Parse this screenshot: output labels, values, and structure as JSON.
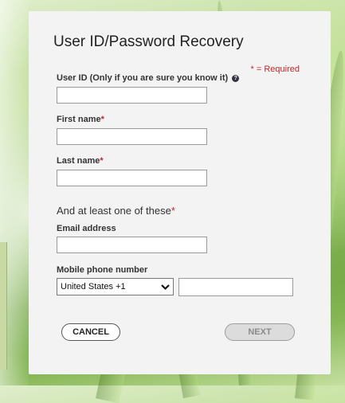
{
  "form": {
    "title": "User ID/Password Recovery",
    "required_note": "* = Required",
    "star": "*",
    "fields": {
      "user_id_label": "User ID (Only if you are sure you know it)",
      "user_id_value": "",
      "first_name_label": "First name",
      "first_name_value": "",
      "last_name_label": "Last name",
      "last_name_value": "",
      "email_label": "Email address",
      "email_value": "",
      "mobile_label": "Mobile phone number",
      "country_selected": "United States +1",
      "phone_value": ""
    },
    "section_heading": "And at least one of these",
    "buttons": {
      "cancel": "CANCEL",
      "next": "NEXT"
    }
  },
  "icons": {
    "help": "help-icon",
    "dropdown": "chevron-down-icon"
  },
  "colors": {
    "required_red": "#c3262b",
    "panel": "#f3f3f3"
  }
}
